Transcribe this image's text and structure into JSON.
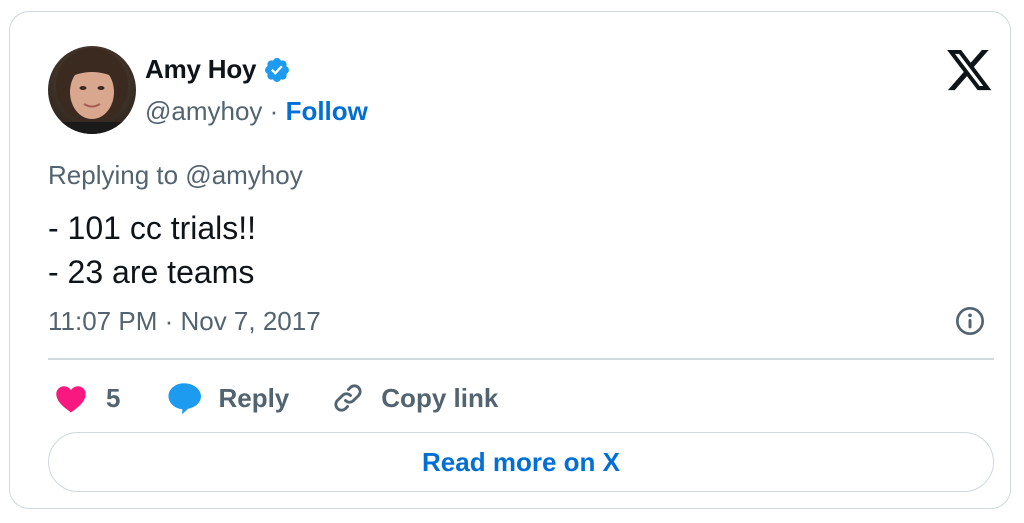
{
  "author": {
    "name": "Amy Hoy",
    "handle": "@amyhoy",
    "separator": "·",
    "follow_label": "Follow",
    "verified": true
  },
  "tweet": {
    "reply_to": "Replying to @amyhoy",
    "lines": [
      "- 101 cc trials!!",
      "- 23 are teams"
    ],
    "timestamp": "11:07 PM · Nov 7, 2017"
  },
  "actions": {
    "like_count": "5",
    "reply_label": "Reply",
    "copy_link_label": "Copy link"
  },
  "read_more_label": "Read more on X",
  "colors": {
    "accent": "#006fd6",
    "heart": "#f91880",
    "reply_bubble": "#1d9bf0",
    "muted_text": "#536471",
    "border": "#cfd9de"
  },
  "icons": [
    "verified-badge-icon",
    "x-logo-icon",
    "info-icon",
    "heart-icon",
    "reply-bubble-icon",
    "link-icon"
  ]
}
